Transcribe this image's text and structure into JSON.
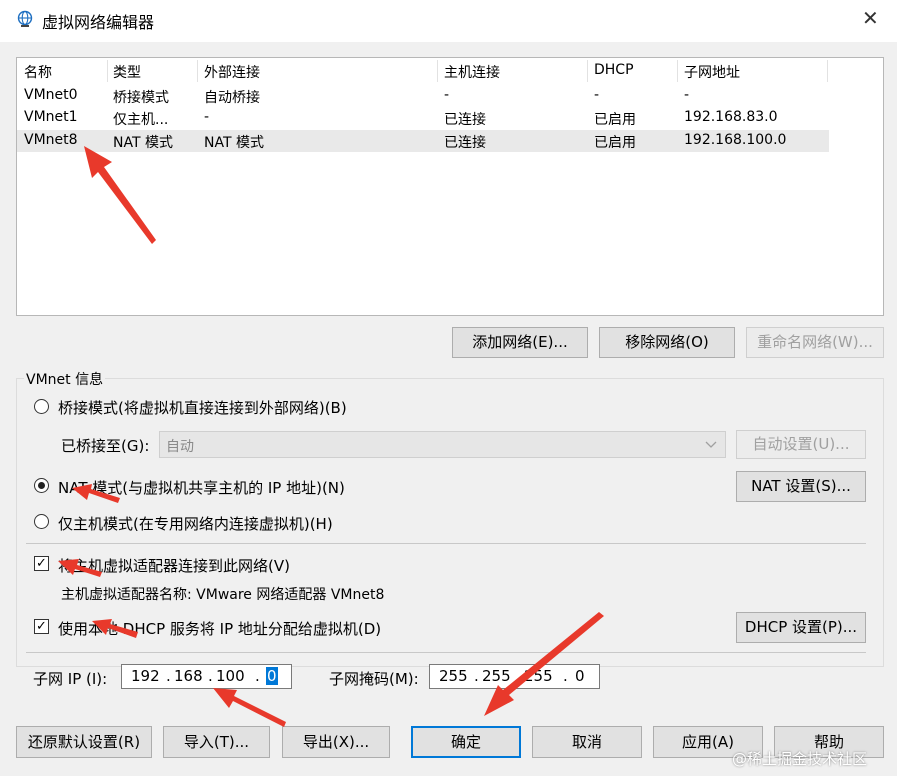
{
  "window": {
    "title": "虚拟网络编辑器",
    "close_label": "✕",
    "icon": "globe-icon"
  },
  "table": {
    "headers": [
      "名称",
      "类型",
      "外部连接",
      "主机连接",
      "DHCP",
      "子网地址"
    ],
    "rows": [
      [
        "VMnet0",
        "桥接模式",
        "自动桥接",
        "-",
        "-",
        "-"
      ],
      [
        "VMnet1",
        "仅主机...",
        "-",
        "已连接",
        "已启用",
        "192.168.83.0"
      ],
      [
        "VMnet8",
        "NAT 模式",
        "NAT 模式",
        "已连接",
        "已启用",
        "192.168.100.0"
      ]
    ],
    "selected_row": 2
  },
  "table_buttons": {
    "add": "添加网络(E)...",
    "remove": "移除网络(O)",
    "rename": "重命名网络(W)..."
  },
  "info": {
    "group_title": "VMnet 信息",
    "bridge_radio": "桥接模式(将虚拟机直接连接到外部网络)(B)",
    "bridged_to_label": "已桥接至(G):",
    "bridged_to_value": "自动",
    "auto_settings": "自动设置(U)...",
    "nat_radio": "NAT 模式(与虚拟机共享主机的 IP 地址)(N)",
    "nat_settings": "NAT 设置(S)...",
    "hostonly_radio": "仅主机模式(在专用网络内连接虚拟机)(H)",
    "connect_adapter_check": "将主机虚拟适配器连接到此网络(V)",
    "adapter_name": "主机虚拟适配器名称: VMware 网络适配器 VMnet8",
    "dhcp_check": "使用本地 DHCP 服务将 IP 地址分配给虚拟机(D)",
    "dhcp_settings": "DHCP 设置(P)...",
    "subnet_ip_label": "子网 IP (I):",
    "subnet_ip": [
      "192",
      "168",
      "100",
      "0"
    ],
    "subnet_mask_label": "子网掩码(M):",
    "subnet_mask": [
      "255",
      "255",
      "255",
      "0"
    ],
    "selected_mode": "nat",
    "connect_adapter_checked": true,
    "dhcp_checked": true
  },
  "footer_buttons": {
    "restore": "还原默认设置(R)",
    "import": "导入(T)...",
    "export": "导出(X)...",
    "ok": "确定",
    "cancel": "取消",
    "apply": "应用(A)",
    "help": "帮助"
  },
  "watermark": "@稀土掘金技术社区",
  "colors": {
    "accent": "#0078d7",
    "annotation": "#e8392b",
    "selected_row": "#e9e9e9"
  }
}
